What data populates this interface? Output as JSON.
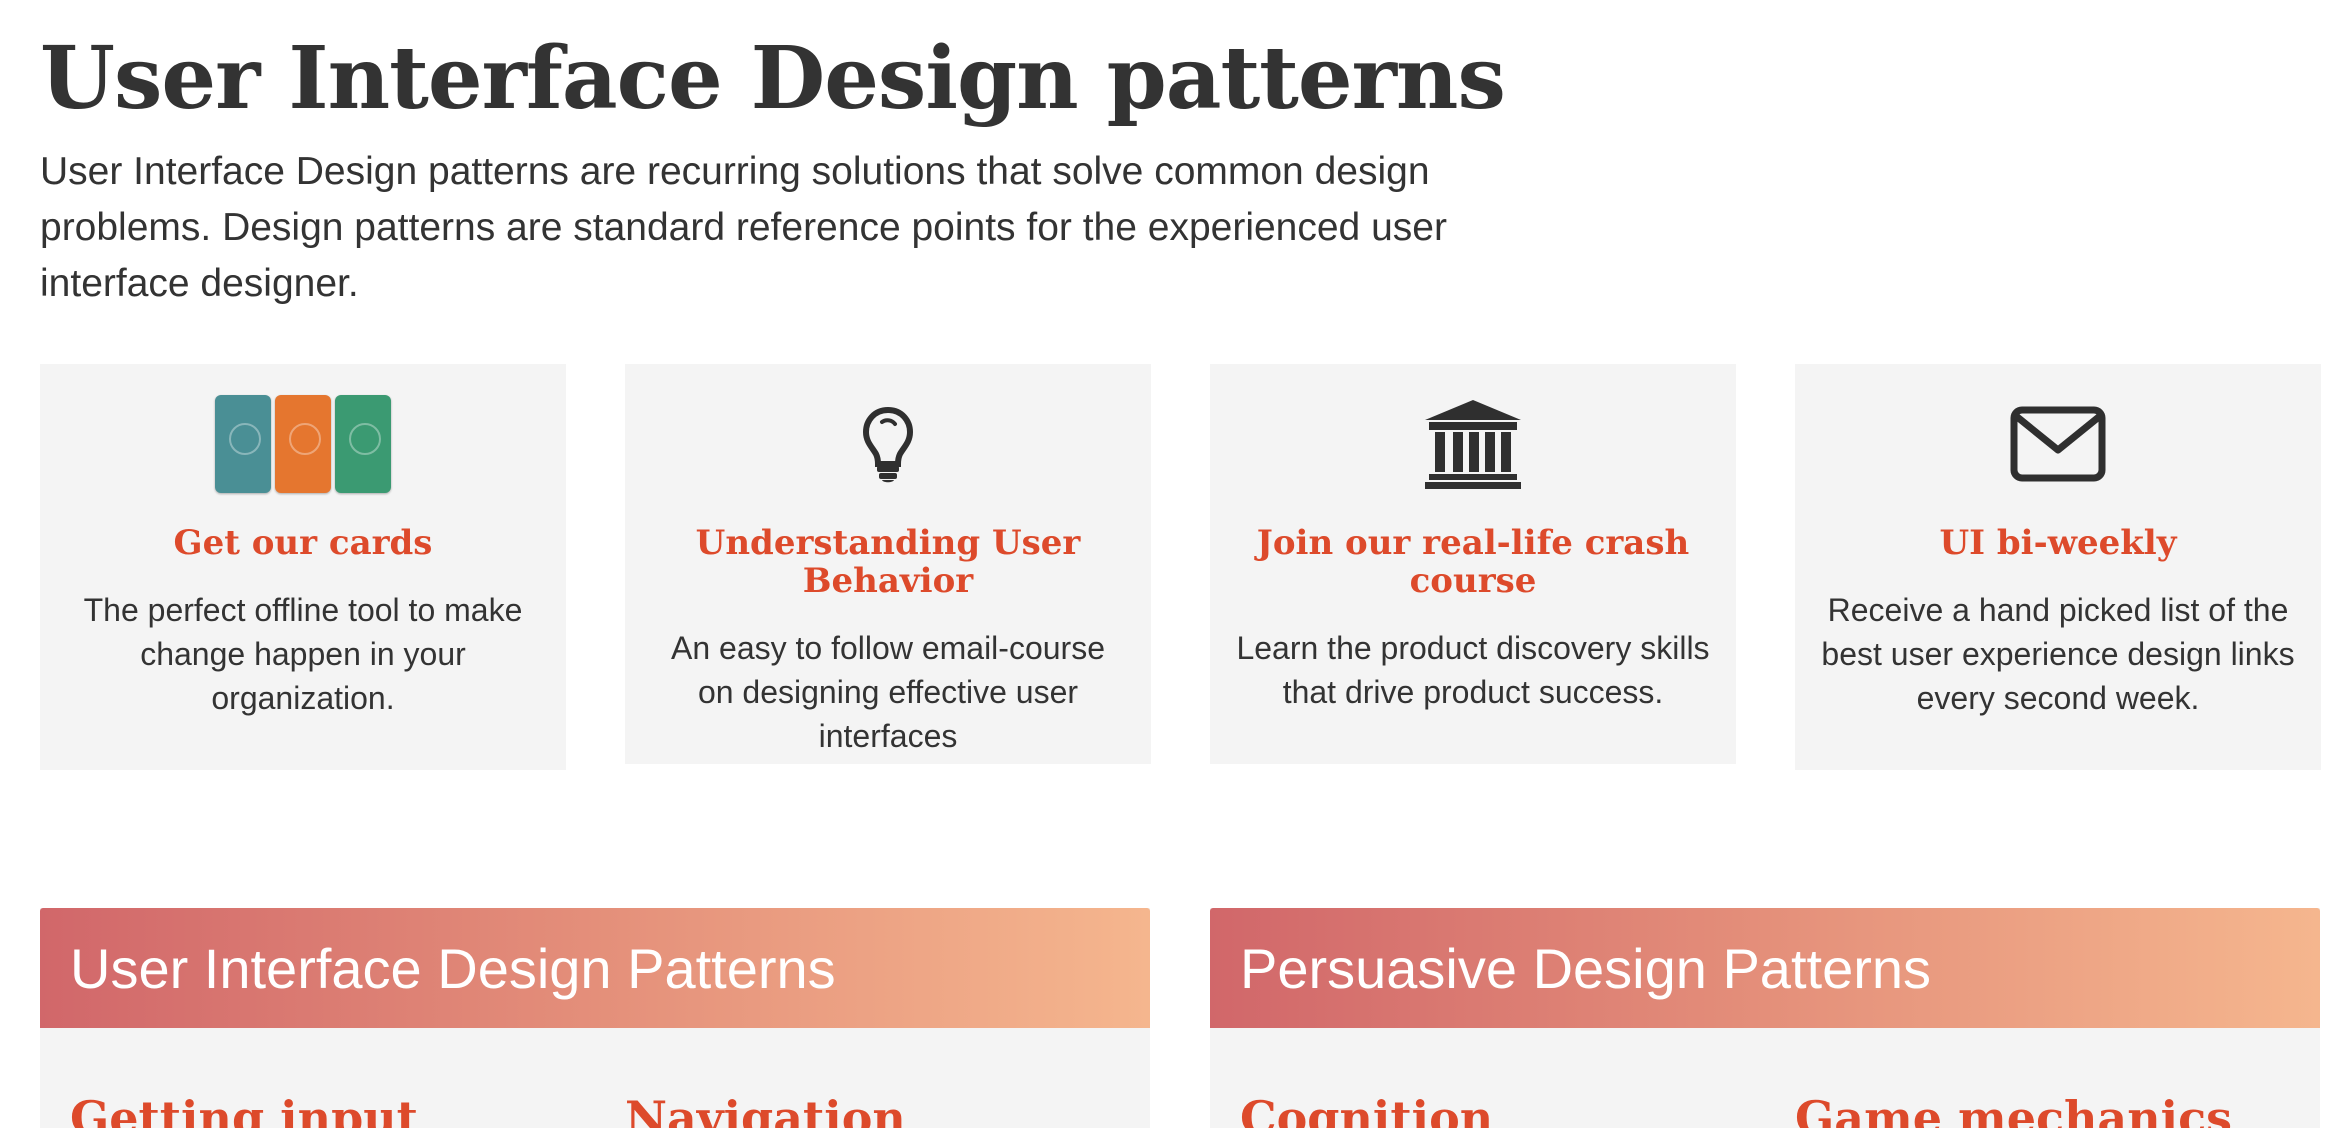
{
  "page": {
    "title": "User Interface Design patterns",
    "intro": "User Interface Design patterns are recurring solutions that solve common design problems. Design patterns are standard reference points for the experienced user interface designer."
  },
  "cards": [
    {
      "icon": "ui-pattern-cards-icon",
      "title": "Get our cards",
      "description": "The perfect offline tool to make change happen in your organization."
    },
    {
      "icon": "lightbulb-icon",
      "title": "Understanding User Behavior",
      "description": "An easy to follow email-course on designing effective user interfaces"
    },
    {
      "icon": "institution-icon",
      "title": "Join our real-life crash course",
      "description": "Learn the product discovery skills that drive product success."
    },
    {
      "icon": "envelope-icon",
      "title": "UI bi-weekly",
      "description": "Receive a hand picked list of the best user experience design links every second week."
    }
  ],
  "panels": [
    {
      "title": "User Interface Design Patterns",
      "columns": [
        "Getting input",
        "Navigation"
      ]
    },
    {
      "title": "Persuasive Design Patterns",
      "columns": [
        "Cognition",
        "Game mechanics"
      ]
    }
  ],
  "colors": {
    "accent": "#dd4a2b",
    "text": "#333333",
    "card_background": "#f4f4f4",
    "panel_gradient_start": "#d1676a",
    "panel_gradient_end": "#f5b68e",
    "cards_teal": "#4a8f95",
    "cards_orange": "#e5762f",
    "cards_green": "#3b9a72"
  }
}
